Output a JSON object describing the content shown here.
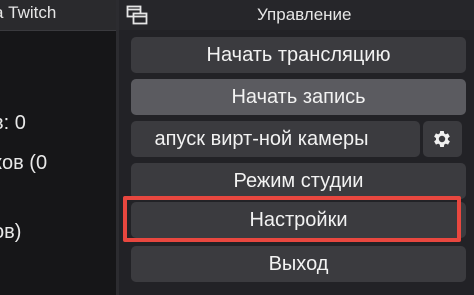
{
  "left_panel": {
    "header_title": "а Twitch",
    "lines": [
      "в: 0",
      "ков (0",
      "ов)"
    ]
  },
  "dock": {
    "title": "Управление",
    "icon": "dock-float-icon",
    "buttons": {
      "start_stream": "Начать трансляцию",
      "start_recording": "Начать запись",
      "virtual_camera": "апуск вирт-ной камеры",
      "studio_mode": "Режим студии",
      "settings": "Настройки",
      "exit": "Выход"
    },
    "gear_icon": "gear-icon"
  },
  "colors": {
    "highlight": "#e8473f",
    "button": "#3b3b3f",
    "button_active": "#5b5b60",
    "background": "#222226"
  }
}
